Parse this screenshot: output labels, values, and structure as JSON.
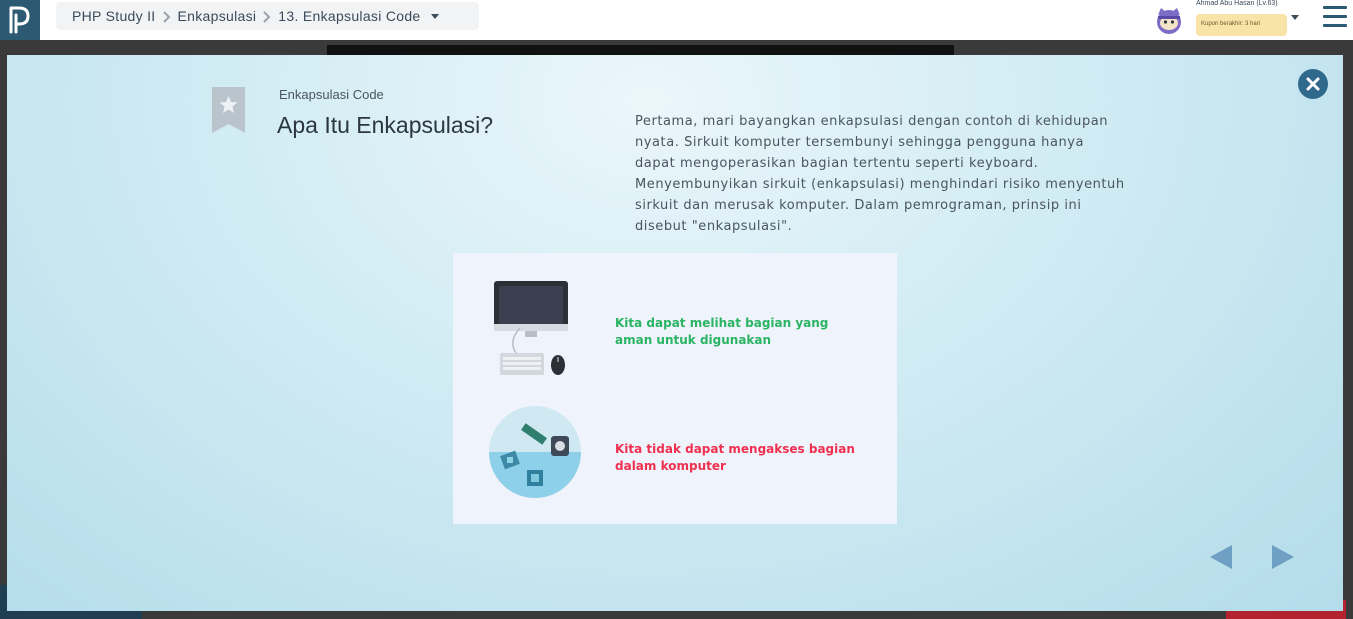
{
  "topbar": {
    "logo_icon": "progate-logo-icon",
    "breadcrumb": [
      "PHP Study II",
      "Enkapsulasi",
      "13. Enkapsulasi Code"
    ],
    "user": {
      "name": "Ahmad Abu Hasan (Lv.63)",
      "coupon": "Kupon berakhir: 3 hari",
      "avatar_icon": "ninja-cat-avatar-icon"
    },
    "menu_icon": "hamburger-icon"
  },
  "modal": {
    "subtitle": "Enkapsulasi Code",
    "title": "Apa Itu Enkapsulasi?",
    "description": "Pertama, mari bayangkan enkapsulasi dengan contoh di kehidupan nyata. Sirkuit komputer tersembunyi sehingga pengguna hanya dapat mengoperasikan bagian tertentu seperti keyboard. Menyembunyikan sirkuit (enkapsulasi) menghindari risiko menyentuh sirkuit dan merusak komputer. Dalam pemrograman, prinsip ini disebut \"enkapsulasi\".",
    "illustration": {
      "caption_visible": "Kita dapat melihat bagian yang aman untuk digunakan",
      "caption_hidden": "Kita tidak dapat mengakses bagian dalam komputer",
      "visible_color": "#2ab463",
      "hidden_color": "#f0304f"
    },
    "close_icon": "close-icon",
    "prev_icon": "arrow-left-icon",
    "next_icon": "arrow-right-icon"
  },
  "colors": {
    "brand": "#2d5a73",
    "accent": "#2f6a8c",
    "nav_arrow": "#6f9fc2"
  }
}
